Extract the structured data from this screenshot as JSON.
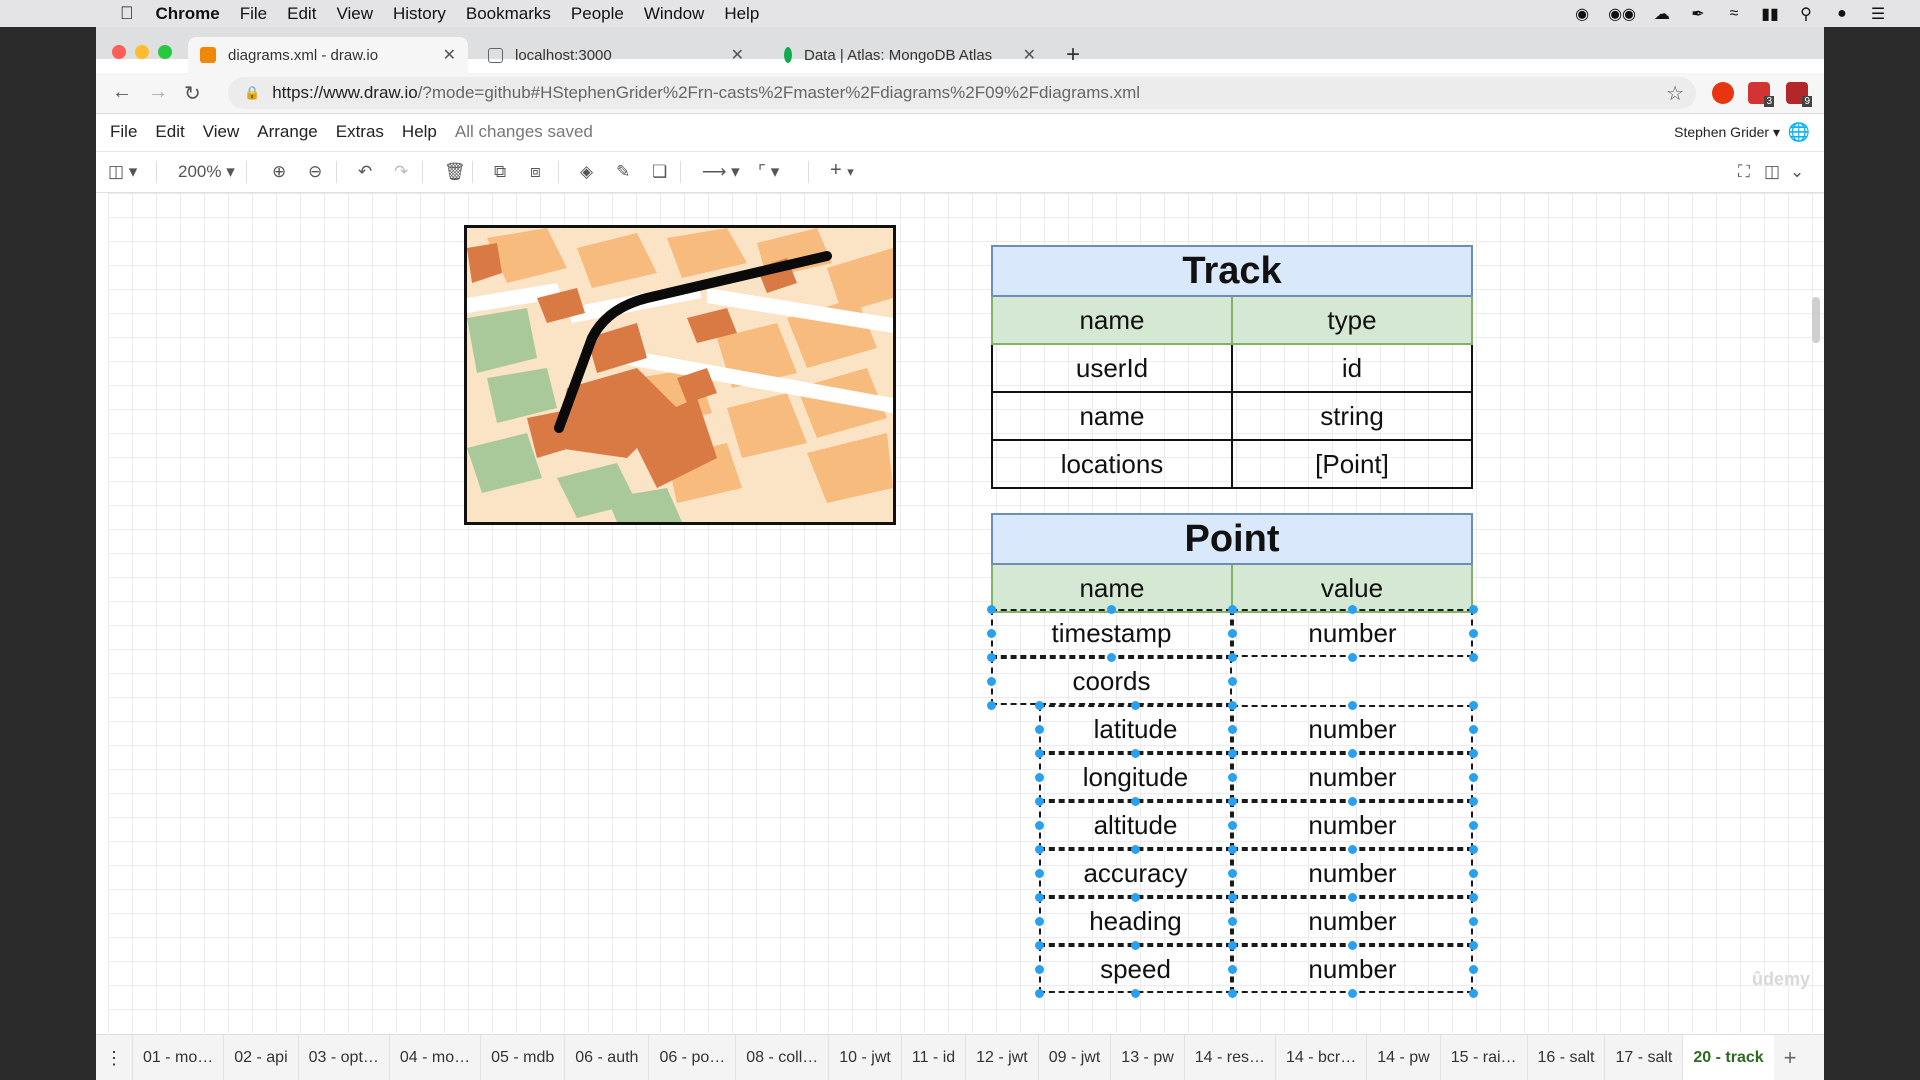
{
  "os_menubar": {
    "app": "Chrome",
    "items": [
      "File",
      "Edit",
      "View",
      "History",
      "Bookmarks",
      "People",
      "Window",
      "Help"
    ]
  },
  "tabs": [
    {
      "title": "diagrams.xml - draw.io",
      "active": true
    },
    {
      "title": "localhost:3000",
      "active": false
    },
    {
      "title": "Data | Atlas: MongoDB Atlas",
      "active": false
    }
  ],
  "url": {
    "host": "https://www.draw.io",
    "path": "/?mode=github#HStephenGrider%2Frn-casts%2Fmaster%2Fdiagrams%2F09%2Fdiagrams.xml"
  },
  "extension_badges": [
    "3",
    "9"
  ],
  "drawio_menu": {
    "items": [
      "File",
      "Edit",
      "View",
      "Arrange",
      "Extras",
      "Help"
    ],
    "status": "All changes saved",
    "user": "Stephen Grider"
  },
  "toolbar": {
    "zoom": "200%"
  },
  "track_table": {
    "title": "Track",
    "headers": [
      "name",
      "type"
    ],
    "rows": [
      [
        "userId",
        "id"
      ],
      [
        "name",
        "string"
      ],
      [
        "locations",
        "[Point]"
      ]
    ]
  },
  "point_table": {
    "title": "Point",
    "headers": [
      "name",
      "value"
    ],
    "timestamp": [
      "timestamp",
      "number"
    ],
    "coords": "coords",
    "sub_rows": [
      [
        "latitude",
        "number"
      ],
      [
        "longitude",
        "number"
      ],
      [
        "altitude",
        "number"
      ],
      [
        "accuracy",
        "number"
      ],
      [
        "heading",
        "number"
      ],
      [
        "speed",
        "number"
      ]
    ]
  },
  "watermark": "ûdemy",
  "page_tabs": {
    "items": [
      "01 - mo…",
      "02 - api",
      "03 - opt…",
      "04 - mo…",
      "05 - mdb",
      "06 - auth",
      "06 - po…",
      "08 - coll…",
      "10 - jwt",
      "11 - id",
      "12 - jwt",
      "09 - jwt",
      "13 - pw",
      "14 - res…",
      "14 - bcr…",
      "14 - pw",
      "15 - rai…",
      "16 - salt",
      "17 - salt"
    ],
    "active": "20 - track"
  }
}
